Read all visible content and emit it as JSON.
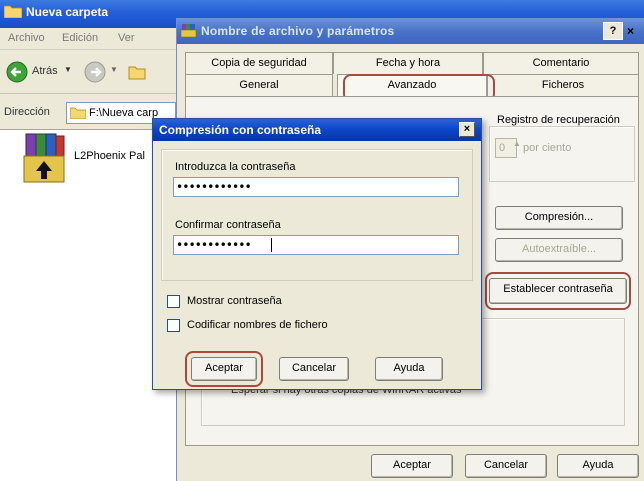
{
  "explorer": {
    "title": "Nueva carpeta",
    "menu": [
      "Archivo",
      "Edición",
      "Ver"
    ],
    "back_label": "Atrás",
    "address_label": "Dirección",
    "address_value": "F:\\Nueva carp",
    "file_name": "L2Phoenix Pal"
  },
  "params_dialog": {
    "title": "Nombre de archivo y parámetros",
    "help_label": "?",
    "close_label": "×",
    "tabs_row1": [
      "Copia de seguridad",
      "Fecha y hora",
      "Comentario"
    ],
    "tabs_row2": [
      "General",
      "Avanzado",
      "Ficheros"
    ],
    "recovery_label": "Registro de recuperación",
    "recovery_value": "0",
    "recovery_unit": "por ciento",
    "compression_button": "Compresión...",
    "autoextract_button": "Autoextraíble...",
    "set_password_button": "Establecer contraseña",
    "truncated_text": "Esperar si hay otras copias de WinRAR activas",
    "ok_button": "Aceptar",
    "cancel_button": "Cancelar",
    "help_button": "Ayuda"
  },
  "password_dialog": {
    "title": "Compresión con contraseña",
    "close_label": "×",
    "enter_label": "Introduzca la contraseña",
    "enter_value": "••••••••••••",
    "confirm_label": "Confirmar contraseña",
    "confirm_value": "••••••••••••",
    "show_password_label": "Mostrar contraseña",
    "encode_names_label": "Codificar nombres de fichero",
    "ok_button": "Aceptar",
    "cancel_button": "Cancelar",
    "help_button": "Ayuda"
  },
  "colors": {
    "highlight_ring": "#a84a3e",
    "titlebar_active": "#0a45c8",
    "dialog_bg": "#ece9d8"
  }
}
